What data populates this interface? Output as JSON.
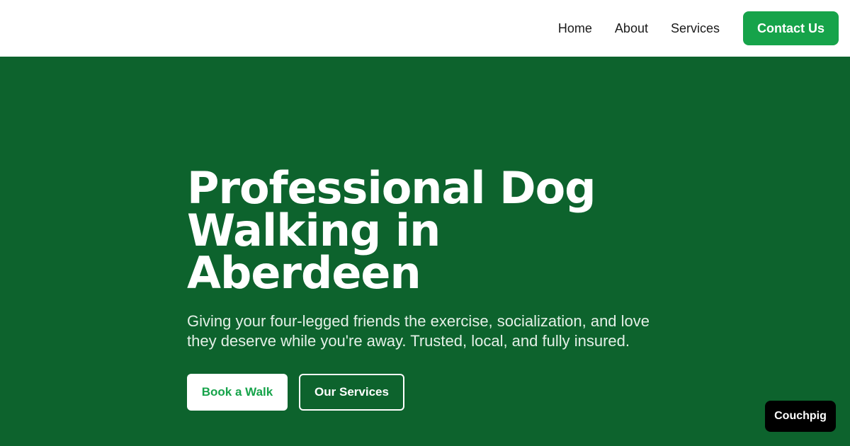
{
  "header": {
    "nav": [
      {
        "label": "Home"
      },
      {
        "label": "About"
      },
      {
        "label": "Services"
      }
    ],
    "contact_label": "Contact Us"
  },
  "hero": {
    "title": "Professional Dog\nWalking in Aberdeen",
    "subtitle": "Giving your four-legged friends the exercise, socialization, and love they deserve while you're away. Trusted, local, and fully insured.",
    "primary_button": "Book a Walk",
    "secondary_button": "Our Services"
  },
  "badge": {
    "label": "Couchpig"
  },
  "colors": {
    "brand_green": "#16a34a",
    "hero_background": "#0d632d"
  }
}
